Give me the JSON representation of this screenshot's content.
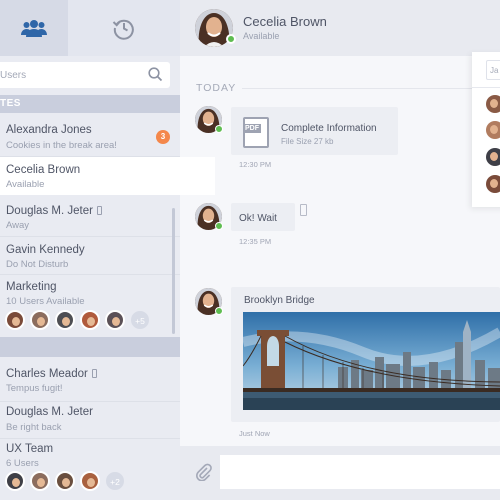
{
  "sidebar": {
    "search_placeholder": "Users",
    "section_1": "TES",
    "items": [
      {
        "name": "Alexandra Jones",
        "sub": "Cookies in the break area!",
        "badge": "3"
      },
      {
        "name": "Cecelia Brown",
        "sub": "Available"
      },
      {
        "name": "Douglas M. Jeter",
        "sub": "Away"
      },
      {
        "name": "Gavin Kennedy",
        "sub": "Do Not Disturb"
      },
      {
        "name": "Marketing",
        "sub": "10 Users Available",
        "more": "+5"
      }
    ],
    "items_2": [
      {
        "name": "Charles Meador",
        "sub": "Tempus fugit!"
      },
      {
        "name": "Douglas M. Jeter",
        "sub": "Be right back"
      },
      {
        "name": "UX Team",
        "sub": "6 Users",
        "more": "+2"
      }
    ]
  },
  "chat": {
    "contact_name": "Cecelia Brown",
    "contact_status": "Available",
    "day_label": "TODAY",
    "messages": [
      {
        "title": "Complete Information",
        "sub": "File Size 27 kb",
        "time": "12:30 PM",
        "file_type": "PDF"
      },
      {
        "text": "Ok! Wait",
        "time": "12:35 PM"
      },
      {
        "title": "Brooklyn Bridge",
        "time": "Just Now"
      }
    ]
  },
  "popup": {
    "search_value": "Ja"
  },
  "colors": {
    "badge": "#f4874b",
    "online": "#5fbd51",
    "brand_blue": "#2f66a8"
  }
}
